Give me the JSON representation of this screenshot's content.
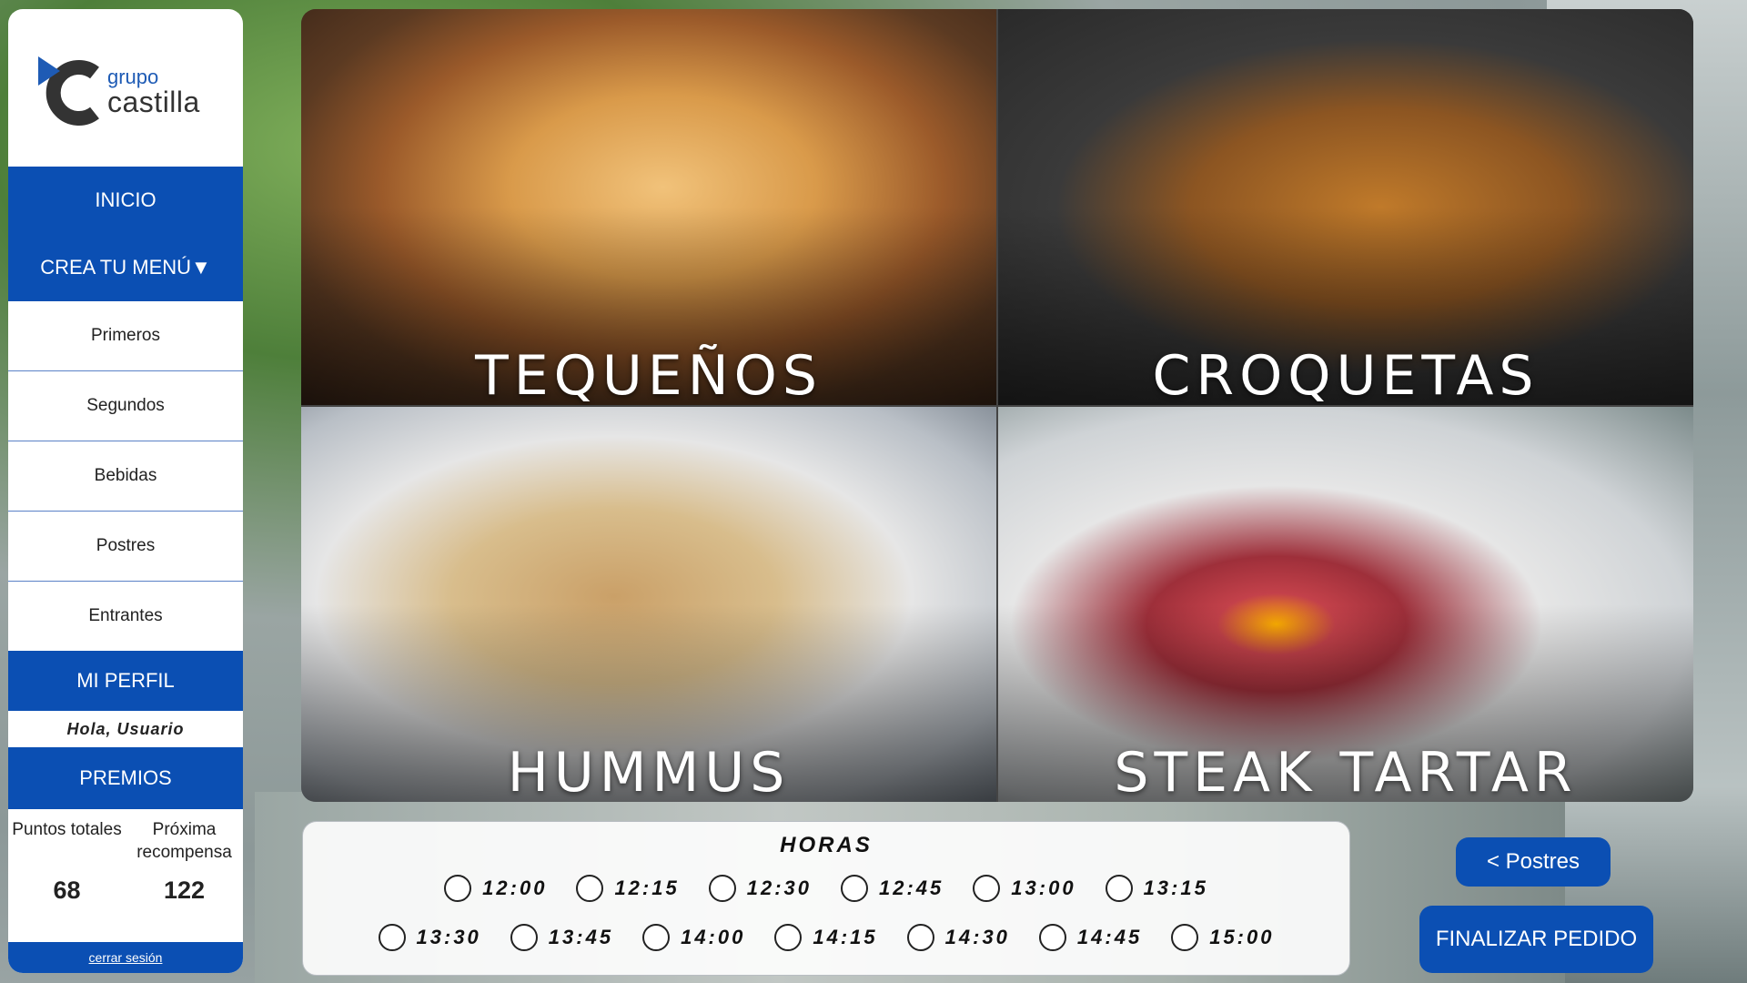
{
  "brand": {
    "small": "grupo",
    "big": "castilla"
  },
  "nav": {
    "home": "INICIO",
    "create_menu": "CREA TU MENÚ",
    "submenu": [
      "Primeros",
      "Segundos",
      "Bebidas",
      "Postres",
      "Entrantes"
    ],
    "profile": "MI PERFIL",
    "greeting": "Hola, Usuario",
    "prizes": "PREMIOS",
    "points_label": "Puntos totales",
    "points_value": "68",
    "next_label": "Próxima recompensa",
    "next_value": "122",
    "logout": "cerrar sesión"
  },
  "dishes": [
    {
      "name": "TEQUEÑOS"
    },
    {
      "name": "CROQUETAS"
    },
    {
      "name": "HUMMUS"
    },
    {
      "name": "STEAK TARTAR"
    }
  ],
  "hours": {
    "title": "HORAS",
    "row1": [
      "12:00",
      "12:15",
      "12:30",
      "12:45",
      "13:00",
      "13:15"
    ],
    "row2": [
      "13:30",
      "13:45",
      "14:00",
      "14:15",
      "14:30",
      "14:45",
      "15:00"
    ]
  },
  "buttons": {
    "back": "< Postres",
    "finish": "FINALIZAR PEDIDO"
  },
  "colors": {
    "primary": "#0b4fb3"
  },
  "icons": {
    "dropdown": "triangle-down-icon"
  }
}
